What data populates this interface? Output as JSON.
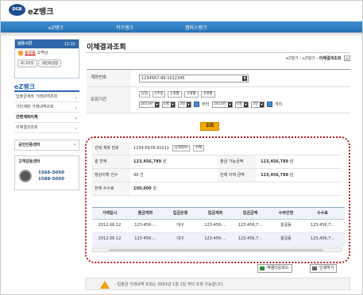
{
  "header": {
    "logo_badge": "DGB",
    "logo_text": "eZ뱅크",
    "nav": [
      "eZ뱅크",
      "키즈뱅크",
      "캠퍼스뱅크"
    ]
  },
  "sidebar": {
    "login": {
      "remaining_label": "남은시간",
      "timer": "12:32",
      "user_name": "홍길동",
      "user_suffix": "고객님",
      "logout_btn": "로그아웃",
      "profile_btn": "개인화설정"
    },
    "section_title": "eZ뱅크",
    "items": [
      "입출금계좌 거래내역조회",
      "기타계좌 거래내역조회",
      "간편계좌이체",
      "이체결과조회"
    ],
    "auth_center": "공인인증센터",
    "cs_center": {
      "title": "고객감동센터",
      "phone1": "1566-5050",
      "phone2": "1588-5050"
    }
  },
  "main": {
    "title": "이체결과조회",
    "breadcrumb": {
      "a": "eZ뱅크",
      "b": "eZ뱅크",
      "current": "이체결과조회",
      "sep": " › "
    },
    "form": {
      "account_label": "계좌번호",
      "account_value": "1234567-89-1012345",
      "period_label": "조회기간",
      "period_buttons": [
        "당일",
        "1주일",
        "1개월",
        "3개월",
        "6개월"
      ],
      "from": {
        "year": "2013년",
        "month": "6월",
        "day": "3일"
      },
      "to": {
        "year": "2013년",
        "month": "6월",
        "day": "3일"
      },
      "from_suffix": "부터",
      "to_suffix": "까지"
    },
    "query_btn": "조회",
    "summary": {
      "selected_account_label": "선택 계좌 번호",
      "selected_account_value": "1234-5678-91011",
      "detail_btn": "상세정보",
      "transfer_btn": "이체",
      "total_balance_label": "총 잔액",
      "total_balance_value": "123,456,789",
      "available_label": "출금 가능금액",
      "available_value": "123,456,789",
      "normal_count_label": "정상이체 건수",
      "normal_count_value": "99",
      "total_amount_label": "전체 이체 금액",
      "total_amount_value": "123,456,789",
      "fee_label": "전체 수수료",
      "fee_value": "100,000",
      "won": "원",
      "count_unit": "건"
    },
    "grid": {
      "headers": [
        "거래일시",
        "출금계좌",
        "입금은행",
        "입금계좌",
        "입금금액",
        "수취인명",
        "수수료"
      ],
      "rows": [
        [
          "2012.06.12",
          "123-456-...",
          "대구",
          "123-456-...",
          "123,456,7...",
          "홍길동",
          "123,456,7..."
        ],
        [
          "2012.06.12",
          "123-456-...",
          "대구",
          "123-456-...",
          "123,456,7...",
          "홍길동",
          "123,456,7..."
        ]
      ]
    },
    "excel_btn": "엑셀다운로드",
    "print_btn": "인쇄하기",
    "notice": "- 입출금 거래내역 조회는 2001년 1월 1일 부터 조회 가능합니다."
  }
}
